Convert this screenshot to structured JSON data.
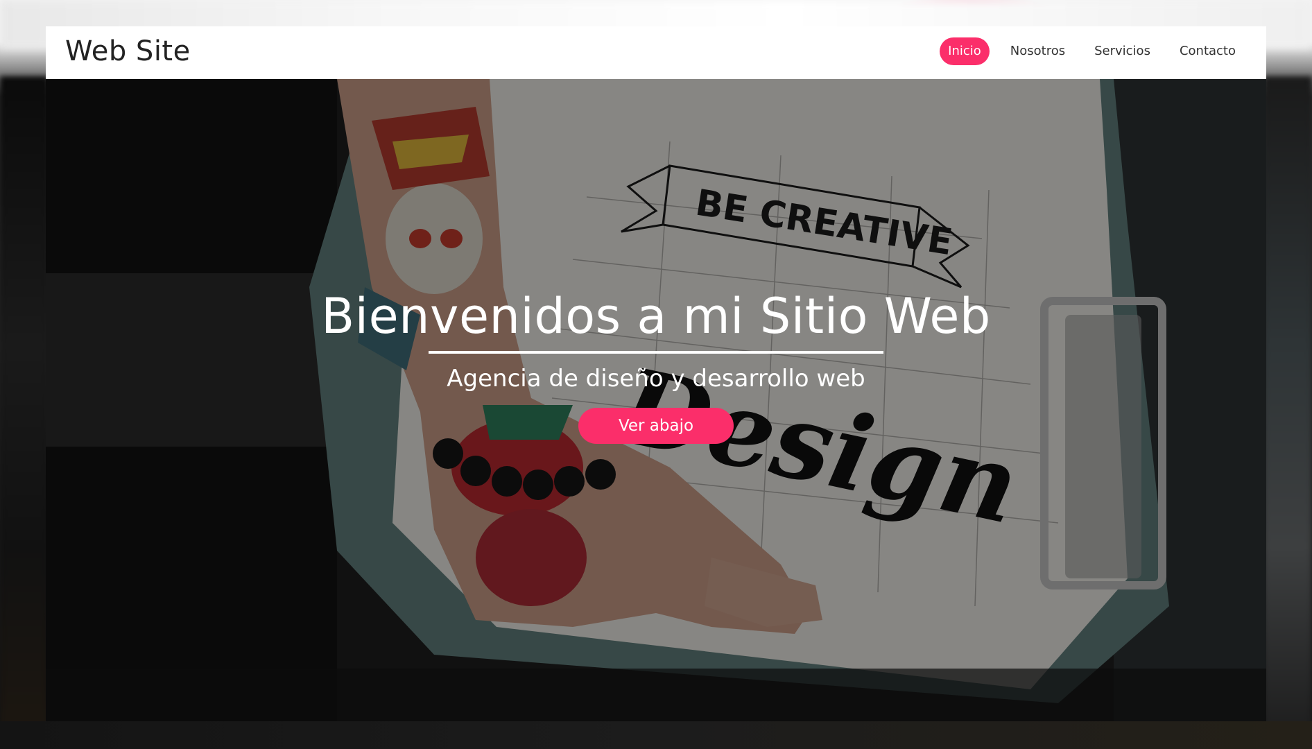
{
  "brand": {
    "logo_text": "Web Site"
  },
  "nav": {
    "items": [
      {
        "label": "Inicio",
        "active": true
      },
      {
        "label": "Nosotros",
        "active": false
      },
      {
        "label": "Servicios",
        "active": false
      },
      {
        "label": "Contacto",
        "active": false
      }
    ]
  },
  "hero": {
    "title": "Bienvenidos a mi Sitio Web",
    "subtitle": "Agencia de diseño y desarrollo web",
    "cta_label": "Ver abajo",
    "photo_text": {
      "banner": "BE CREATIVE",
      "script": "Design"
    }
  },
  "colors": {
    "accent": "#fb2e6a",
    "header_bg": "#ffffff",
    "hero_text": "#ffffff"
  }
}
